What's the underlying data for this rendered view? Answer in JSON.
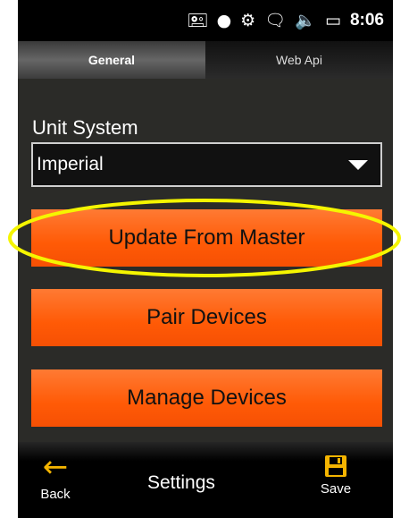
{
  "status_bar": {
    "icons": [
      "phone-data-icon",
      "record-dot-icon",
      "wifi-icon",
      "no-signal-icon",
      "speaker-icon",
      "battery-icon"
    ],
    "time": "8:06"
  },
  "tabs": [
    {
      "label": "General",
      "active": true
    },
    {
      "label": "Web Api",
      "active": false
    }
  ],
  "form": {
    "unit_system_label": "Unit System",
    "unit_system_value": "Imperial"
  },
  "buttons": {
    "update_from_master": "Update From Master",
    "pair_devices": "Pair Devices",
    "manage_devices": "Manage Devices"
  },
  "bottom_bar": {
    "back_label": "Back",
    "title": "Settings",
    "save_label": "Save"
  },
  "colors": {
    "accent_orange": "#ff6010",
    "highlight_yellow": "#f5f500",
    "back_icon": "#f4b400"
  }
}
